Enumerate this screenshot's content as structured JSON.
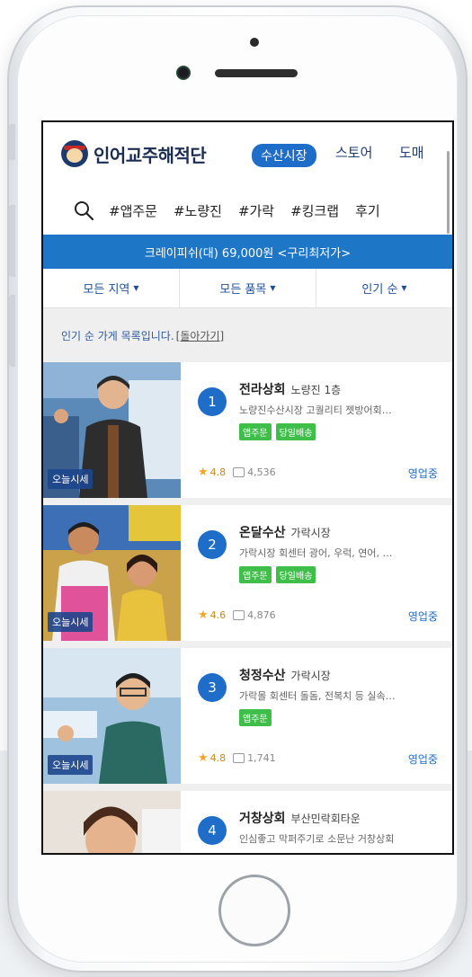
{
  "app": {
    "logo_text": "인어교주해적단"
  },
  "nav": {
    "active": "수산시장",
    "store": "스토어",
    "wholesale": "도매"
  },
  "tags": [
    "#앱주문",
    "#노량진",
    "#가락",
    "#킹크랩",
    "후기"
  ],
  "promo": {
    "text": "크레이피쉬(대) 69,000원 <구리최저가>"
  },
  "filters": {
    "region": "모든 지역",
    "product": "모든 품목",
    "sort": "인기 순"
  },
  "notice": {
    "text": "인기 순 가게 목록입니다. ",
    "back": "[돌아가기]"
  },
  "stores": [
    {
      "rank": "1",
      "name": "전라상회",
      "location": "노량진 1층",
      "desc": "노량진수산시장 고퀄리티 젯방어회…",
      "chips": [
        "앱주문",
        "당일배송"
      ],
      "rating": "4.8",
      "comments": "4,536",
      "status": "영업중",
      "live": "오늘시세"
    },
    {
      "rank": "2",
      "name": "온달수산",
      "location": "가락시장",
      "desc": "가락시장 회센터 광어, 우럭, 연어, …",
      "chips": [
        "앱주문",
        "당일배송"
      ],
      "rating": "4.6",
      "comments": "4,876",
      "status": "영업중",
      "live": "오늘시세"
    },
    {
      "rank": "3",
      "name": "청정수산",
      "location": "가락시장",
      "desc": "가락몰 회센터 돌돔, 전복치 등 실속…",
      "chips": [
        "앱주문"
      ],
      "rating": "4.8",
      "comments": "1,741",
      "status": "영업중",
      "live": "오늘시세"
    },
    {
      "rank": "4",
      "name": "거창상회",
      "location": "부산민락회타운",
      "desc": "인심좋고 막퍼주기로 소문난 거창상회",
      "chips": [],
      "rating": "",
      "comments": "",
      "status": "",
      "live": ""
    }
  ],
  "colors": {
    "primary": "#1e6dc9",
    "promo": "#1e76c6",
    "chip": "#3fbf4a",
    "star": "#f5a623"
  }
}
